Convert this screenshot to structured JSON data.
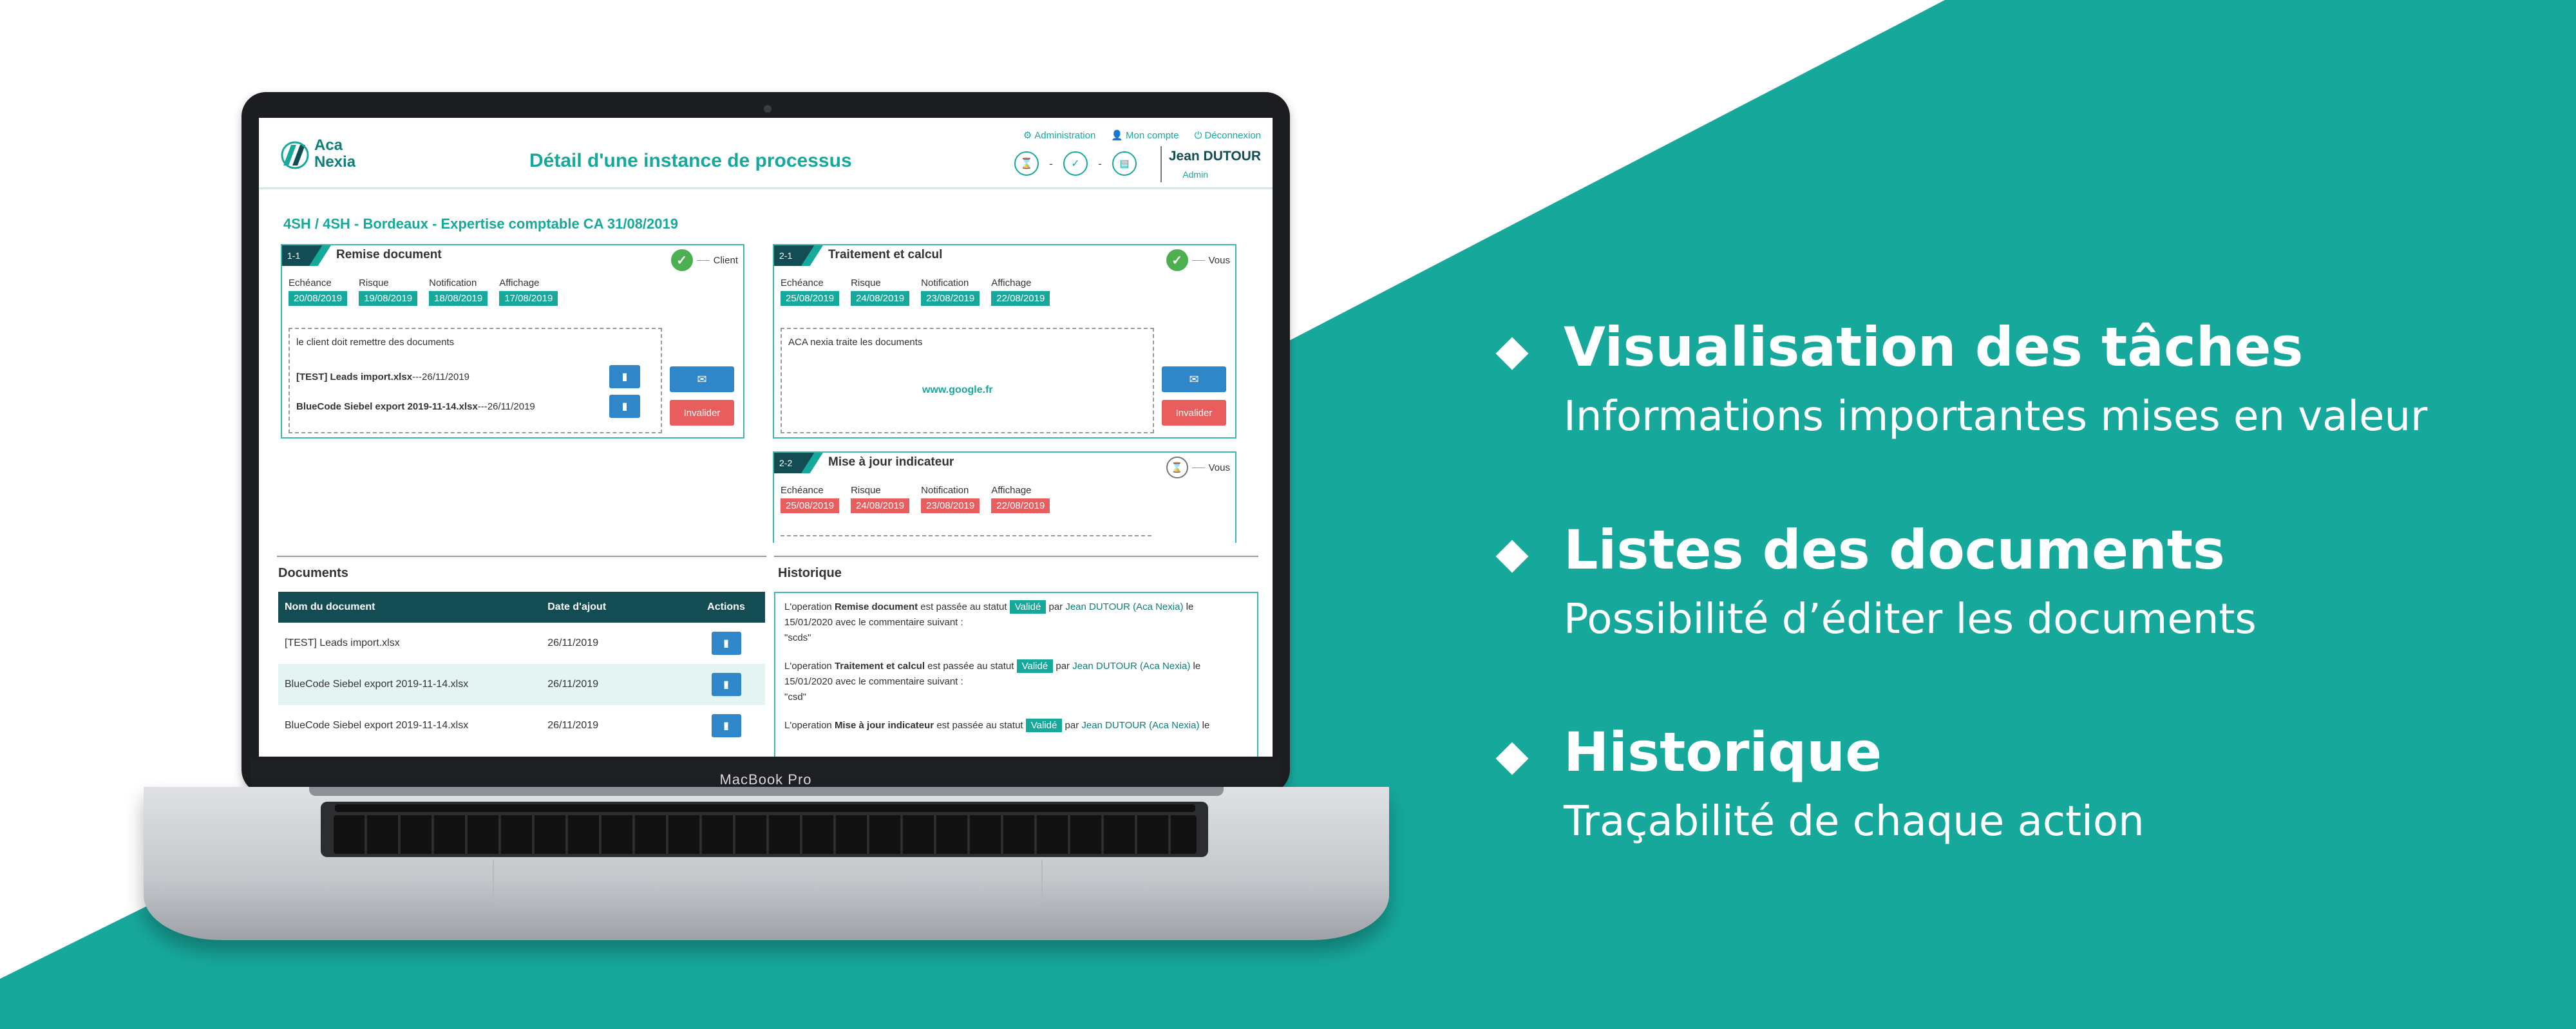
{
  "colors": {
    "teal": "#17a89c",
    "dark_teal": "#134d53",
    "red": "#e85d5d",
    "blue": "#2f86c8",
    "green": "#4caf50"
  },
  "laptop": {
    "model_label": "MacBook Pro"
  },
  "app": {
    "logo_line1": "Aca",
    "logo_line2": "Nexia",
    "title": "Détail d'une instance de processus",
    "top_links": {
      "admin": "Administration",
      "account": "Mon compte",
      "logout": "Déconnexion"
    },
    "header_icons": [
      "hourglass-icon",
      "clipboard-check-icon",
      "document-icon"
    ],
    "separator": "-",
    "user_name": "Jean DUTOUR",
    "user_role": "Admin",
    "breadcrumb": "4SH / 4SH - Bordeaux - Expertise comptable CA 31/08/2019",
    "field_labels": {
      "due": "Echéance",
      "risk": "Risque",
      "notification": "Notification",
      "display": "Affichage"
    },
    "tasks": [
      {
        "tag": "1-1",
        "title": "Remise document",
        "status": "Client",
        "dates": {
          "due": "20/08/2019",
          "risk": "19/08/2019",
          "notification": "18/08/2019",
          "display": "17/08/2019"
        },
        "description": "le client doit remettre des documents",
        "docs": [
          {
            "name": "[TEST] Leads import.xlsx",
            "sep": "---",
            "date": "26/11/2019"
          },
          {
            "name": "BlueCode Siebel export 2019-11-14.xlsx",
            "sep": "---",
            "date": "26/11/2019"
          }
        ],
        "invalidate_label": "Invalider"
      },
      {
        "tag": "2-1",
        "title": "Traitement et calcul",
        "status": "Vous",
        "dates": {
          "due": "25/08/2019",
          "risk": "24/08/2019",
          "notification": "23/08/2019",
          "display": "22/08/2019"
        },
        "description": "ACA nexia traite les documents",
        "link": "www.google.fr",
        "invalidate_label": "Invalider"
      },
      {
        "tag": "2-2",
        "title": "Mise à jour indicateur",
        "status": "Vous",
        "dates": {
          "due": "25/08/2019",
          "risk": "24/08/2019",
          "notification": "23/08/2019",
          "display": "22/08/2019"
        }
      }
    ],
    "documents": {
      "title": "Documents",
      "columns": [
        "Nom du document",
        "Date d'ajout",
        "Actions"
      ],
      "rows": [
        {
          "name": "[TEST] Leads import.xlsx",
          "date": "26/11/2019"
        },
        {
          "name": "BlueCode Siebel export 2019-11-14.xlsx",
          "date": "26/11/2019"
        },
        {
          "name": "BlueCode Siebel export 2019-11-14.xlsx",
          "date": "26/11/2019"
        }
      ]
    },
    "history": {
      "title": "Historique",
      "entries": [
        {
          "p1": "L'operation ",
          "op": "Remise document",
          "p2": " est passée au statut ",
          "status": "Validé",
          "p3": " par ",
          "who": "Jean DUTOUR (Aca Nexia)",
          "p4": " le",
          "date": "15/01/2020",
          "p5": " avec le commentaire suivant :",
          "comment": "\"scds\""
        },
        {
          "p1": "L'operation ",
          "op": "Traitement et calcul",
          "p2": " est passée au statut ",
          "status": "Validé",
          "p3": " par ",
          "who": "Jean DUTOUR (Aca Nexia)",
          "p4": " le",
          "date": "15/01/2020",
          "p5": " avec le commentaire suivant :",
          "comment": "\"csd\""
        },
        {
          "p1": "L'operation ",
          "op": "Mise à jour indicateur",
          "p2": " est passée au statut ",
          "status": "Validé",
          "p3": " par ",
          "who": "Jean DUTOUR (Aca Nexia)",
          "p4": " le",
          "date": "",
          "p5": "",
          "comment": ""
        }
      ]
    }
  },
  "features": [
    {
      "title": "Visualisation des tâches",
      "subtitle": "Informations importantes mises en valeur"
    },
    {
      "title": "Listes des documents",
      "subtitle": "Possibilité d’éditer les documents"
    },
    {
      "title": "Historique",
      "subtitle": "Traçabilité de chaque action"
    }
  ]
}
